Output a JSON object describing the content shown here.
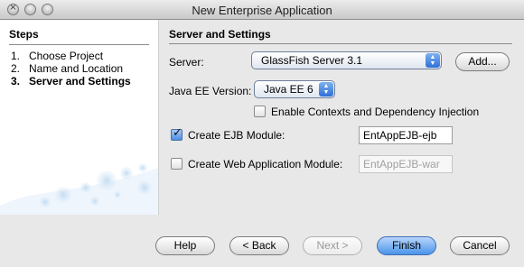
{
  "window": {
    "title": "New Enterprise Application"
  },
  "steps": {
    "heading": "Steps",
    "items": [
      {
        "num": "1.",
        "label": "Choose Project"
      },
      {
        "num": "2.",
        "label": "Name and Location"
      },
      {
        "num": "3.",
        "label": "Server and Settings"
      }
    ],
    "current_step": 3
  },
  "panel": {
    "title": "Server and Settings",
    "server_label": "Server:",
    "server_value": "GlassFish Server 3.1",
    "add_button": "Add...",
    "javaee_label": "Java EE Version:",
    "javaee_value": "Java EE 6",
    "cdi_label": "Enable Contexts and Dependency Injection",
    "cdi_checked": false,
    "ejb_label": "Create EJB Module:",
    "ejb_checked": true,
    "ejb_value": "EntAppEJB-ejb",
    "web_label": "Create Web Application Module:",
    "web_checked": false,
    "web_value": "EntAppEJB-war"
  },
  "footer": {
    "help": "Help",
    "back": "< Back",
    "next": "Next >",
    "finish": "Finish",
    "cancel": "Cancel"
  },
  "icons": {
    "check": "✓",
    "close": "×",
    "select_up": "▲",
    "select_down": "▼"
  },
  "colors": {
    "accent_blue": "#4a93ea",
    "window_bg": "#e8e8e8",
    "steps_bg": "#ffffff"
  }
}
